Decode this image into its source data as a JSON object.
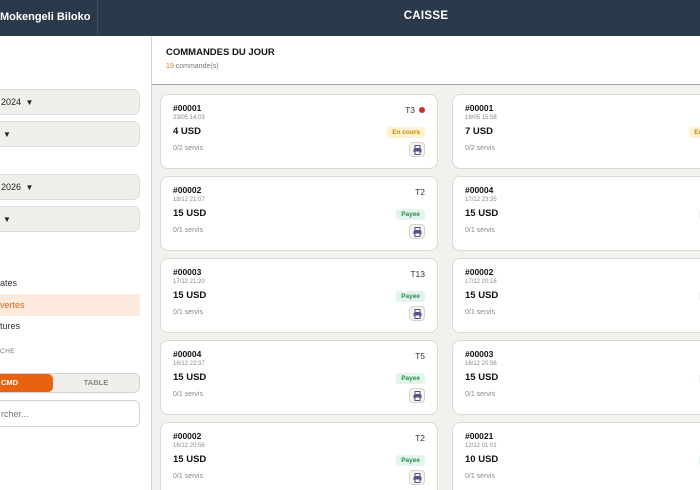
{
  "header": {
    "brand": "Mokengeli Biloko",
    "title": "CAISSE"
  },
  "sidebar": {
    "date_from": "2024",
    "date_to": "2026",
    "filters": [
      "ates",
      "vertes",
      "tures"
    ],
    "active_filter": 1,
    "search_label": "CHE",
    "toggle": {
      "cmd": "CMD",
      "table": "TABLE"
    },
    "search_placeholder": "rcher..."
  },
  "main": {
    "title": "COMMANDES DU JOUR",
    "count": "19",
    "count_suffix": "commande(s)"
  },
  "colors": {
    "topbar": "#2b3a4a",
    "accent": "#e8620f",
    "paid": "#2b8a55",
    "in_progress": "#c98a07"
  },
  "orders_left": [
    {
      "num": "#00001",
      "date": "23/05 14:03",
      "amount": "4 USD",
      "served": "0/2 servis",
      "table": "T3",
      "status": "En cours",
      "status_type": "progress",
      "alert": true
    },
    {
      "num": "#00002",
      "date": "18/12 21:07",
      "amount": "15 USD",
      "served": "0/1 servis",
      "table": "T2",
      "status": "Payee",
      "status_type": "paid"
    },
    {
      "num": "#00003",
      "date": "17/12 21:20",
      "amount": "15 USD",
      "served": "0/1 servis",
      "table": "T13",
      "status": "Payee",
      "status_type": "paid"
    },
    {
      "num": "#00004",
      "date": "16/12 22:37",
      "amount": "15 USD",
      "served": "0/1 servis",
      "table": "T5",
      "status": "Payee",
      "status_type": "paid"
    },
    {
      "num": "#00002",
      "date": "16/12 20:56",
      "amount": "15 USD",
      "served": "0/1 servis",
      "table": "T2",
      "status": "Payee",
      "status_type": "paid"
    }
  ],
  "orders_right": [
    {
      "num": "#00001",
      "date": "19/05 15:58",
      "amount": "7 USD",
      "served": "0/2 servis",
      "table": "",
      "status": "En co",
      "status_type": "progress"
    },
    {
      "num": "#00004",
      "date": "17/12 23:35",
      "amount": "15 USD",
      "served": "0/1 servis",
      "table": "",
      "status": "Pa",
      "status_type": "paid"
    },
    {
      "num": "#00002",
      "date": "17/12 20:16",
      "amount": "15 USD",
      "served": "0/1 servis",
      "table": "",
      "status": "Pa",
      "status_type": "paid"
    },
    {
      "num": "#00003",
      "date": "16/12 20:56",
      "amount": "15 USD",
      "served": "0/1 servis",
      "table": "",
      "status": "Pa",
      "status_type": "paid"
    },
    {
      "num": "#00021",
      "date": "12/12 01:01",
      "amount": "10 USD",
      "served": "0/1 servis",
      "table": "",
      "status": "Pa",
      "status_type": "paid"
    }
  ],
  "icons": {
    "print": "printer-icon",
    "dropdown": "caret-down-icon",
    "alert": "red-dot-icon"
  }
}
